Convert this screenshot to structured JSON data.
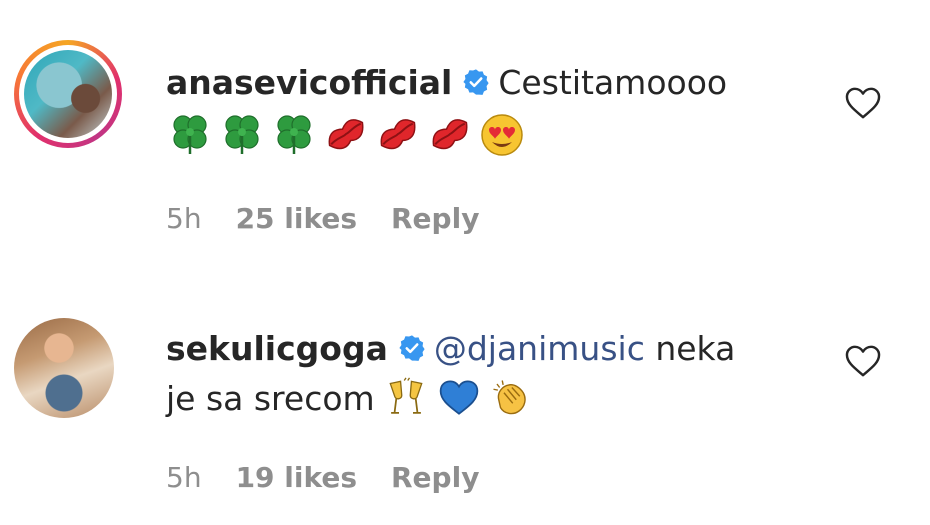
{
  "comments": [
    {
      "username": "anasevicofficial",
      "verified": true,
      "text": "Cestitamoooo",
      "emoji": [
        "four-leaf-clover",
        "four-leaf-clover",
        "four-leaf-clover",
        "kiss-mark",
        "kiss-mark",
        "kiss-mark",
        "heart-eyes-face"
      ],
      "time": "5h",
      "likes": "25 likes",
      "reply_label": "Reply",
      "has_story_ring": true
    },
    {
      "username": "sekulicgoga",
      "verified": true,
      "mention": "@djanimusic",
      "text_line1": " neka",
      "text_line2": "je sa srecom",
      "emoji": [
        "clinking-glasses",
        "blue-heart",
        "clapping-hands"
      ],
      "time": "5h",
      "likes": "19 likes",
      "reply_label": "Reply",
      "has_story_ring": false
    }
  ],
  "colors": {
    "username": "#262626",
    "meta": "#8e8e8e",
    "mention": "#385185",
    "verified_badge": "#3897f0"
  },
  "icons": [
    "verified-badge-icon",
    "heart-outline-icon"
  ]
}
